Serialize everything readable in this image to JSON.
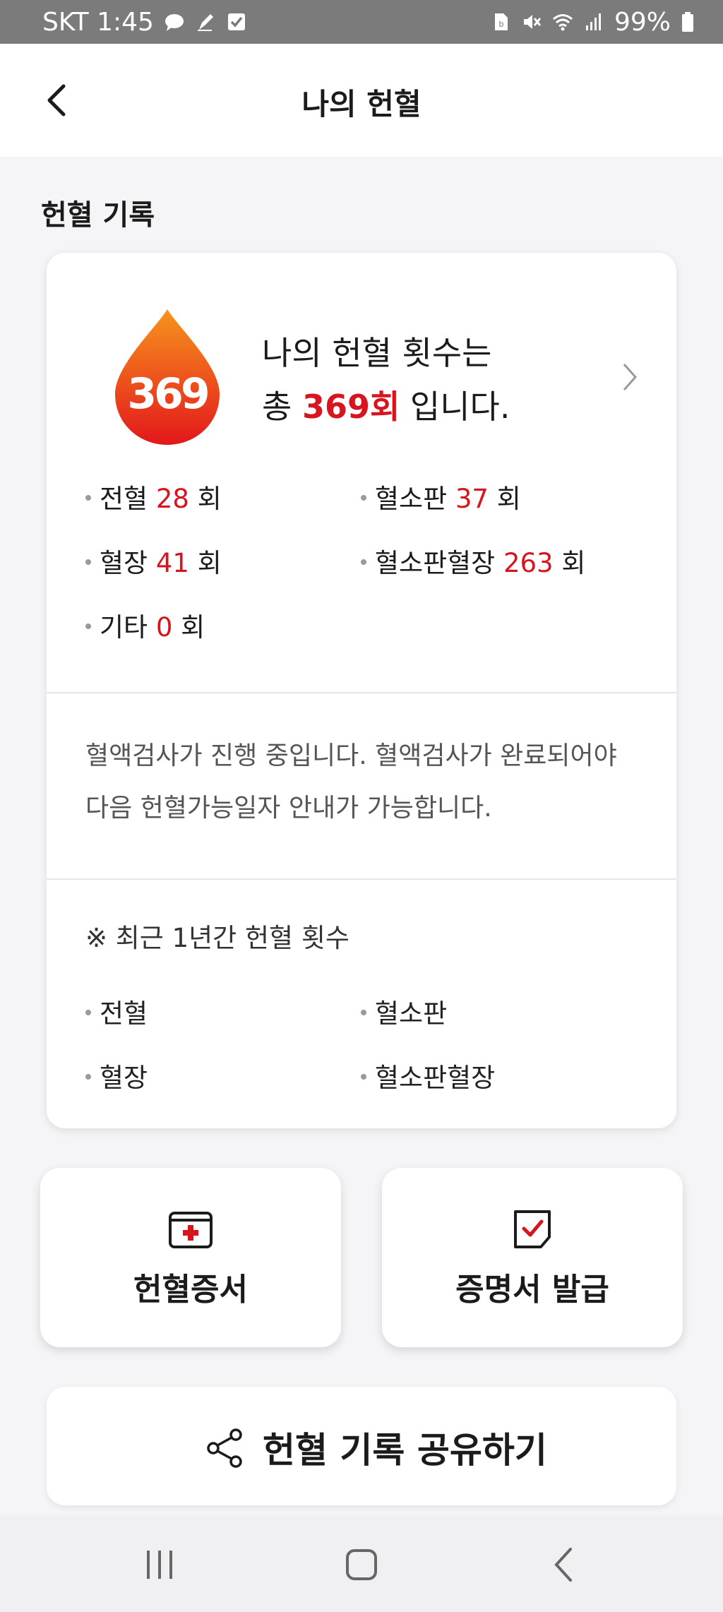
{
  "status_bar": {
    "carrier_time": "SKT 1:45",
    "battery": "99%"
  },
  "header": {
    "title": "나의 헌혈"
  },
  "section": {
    "title": "헌혈 기록"
  },
  "summary": {
    "badge_count": "369",
    "line1": "나의 헌혈 횟수는",
    "line2_prefix": "총 ",
    "line2_count": "369회",
    "line2_suffix": " 입니다."
  },
  "stats": [
    {
      "label": "전혈",
      "value": "28",
      "unit": "회"
    },
    {
      "label": "혈소판",
      "value": "37",
      "unit": "회"
    },
    {
      "label": "혈장",
      "value": "41",
      "unit": "회"
    },
    {
      "label": "혈소판혈장",
      "value": "263",
      "unit": "회"
    },
    {
      "label": "기타",
      "value": "0",
      "unit": "회"
    }
  ],
  "notice": "혈액검사가 진행 중입니다. 혈액검사가 완료되어야 다음 헌혈가능일자 안내가 가능합니다.",
  "recent": {
    "title": "※ 최근 1년간 헌혈 횟수",
    "items": [
      "전혈",
      "혈소판",
      "혈장",
      "혈소판혈장"
    ]
  },
  "actions": {
    "certificate": "헌혈증서",
    "issue": "증명서 발급"
  },
  "share": {
    "label": "헌혈 기록 공유하기"
  },
  "colors": {
    "accent": "#d8141f",
    "drop_top": "#f7941d",
    "drop_bottom": "#e3171b"
  }
}
